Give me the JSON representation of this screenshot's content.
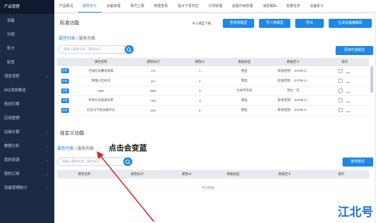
{
  "sidebar": {
    "items": [
      {
        "label": "产品管理",
        "active": true
      },
      {
        "label": "设备",
        "sub": true
      },
      {
        "label": "分组",
        "sub": true
      },
      {
        "label": "机卡",
        "sub": true
      },
      {
        "label": "标签",
        "sub": true
      },
      {
        "label": "消息流转",
        "chev": true
      },
      {
        "label": "MQ消息推送"
      },
      {
        "label": "规则引擎"
      },
      {
        "label": "应用管理"
      },
      {
        "label": "边缘计算",
        "chev": true
      },
      {
        "label": "数据分析",
        "chev": true
      },
      {
        "label": "我的资源",
        "chev": true
      },
      {
        "label": "我的订单",
        "chev": true
      },
      {
        "label": "设备管理统计",
        "chev": true
      }
    ]
  },
  "tabs": [
    "产品概况",
    "服务定义",
    "设备管理",
    "事件上报",
    "数据查看",
    "指令下发日志",
    "订阅管理",
    "远程升级管理",
    "消息路由",
    "批量任务",
    "设备影子"
  ],
  "active_tab": 1,
  "standard": {
    "title": "标准功能",
    "crumb_link": "属性列表",
    "crumb_sep": " / ",
    "crumb_rest": "服务列表",
    "export_label": "导入模型下载",
    "buttons": [
      "查看物模型",
      "导入物模型",
      "导出",
      "生成设备编解码"
    ],
    "search_placeholder": "请输入属性名称、属性标识",
    "add_button": "添加可选属性",
    "columns": [
      "",
      "属性名称",
      "属性标识",
      "属性ID",
      "数据类型",
      "数据定义",
      "操作"
    ],
    "rows": [
      {
        "badge": "必选",
        "name": "无线信号覆盖等级",
        "ident": "ecl",
        "id": "1",
        "type": "整型",
        "def": "取值范围：-32768-3..."
      },
      {
        "badge": "必选",
        "name": "物理小区标识",
        "ident": "pci",
        "id": "2",
        "type": "整型",
        "def": "取值范围：-32768-3..."
      },
      {
        "badge": "必选",
        "name": "IMEI",
        "ident": "IMEI",
        "id": "3",
        "type": "文本字符串",
        "def": "单位：无"
      },
      {
        "badge": "必选",
        "name": "参考信号接收功率",
        "ident": "rsrp",
        "id": "4",
        "type": "整型",
        "def": "取值范围：-32768-3..."
      },
      {
        "badge": "必选",
        "name": "信号与干扰加噪声比",
        "ident": "sinr",
        "id": "5",
        "type": "整型",
        "def": "取值范围：-32768-3..."
      }
    ]
  },
  "custom": {
    "title": "自定义功能",
    "crumb_link": "属性列表",
    "crumb_sep": " / ",
    "crumb_rest": "服务列表",
    "search_placeholder": "请输入属性名称、属性标识",
    "add_button": "新增属性",
    "columns": [
      "属性名称",
      "属性标识",
      "属性ID",
      "数据类型",
      "数据定义",
      "操作"
    ],
    "empty": "暂无数据"
  },
  "annotation": "点击会变蓝",
  "watermark": "江北号",
  "colors": {
    "accent": "#1e88e5",
    "sidebar": "#1c2b45"
  }
}
